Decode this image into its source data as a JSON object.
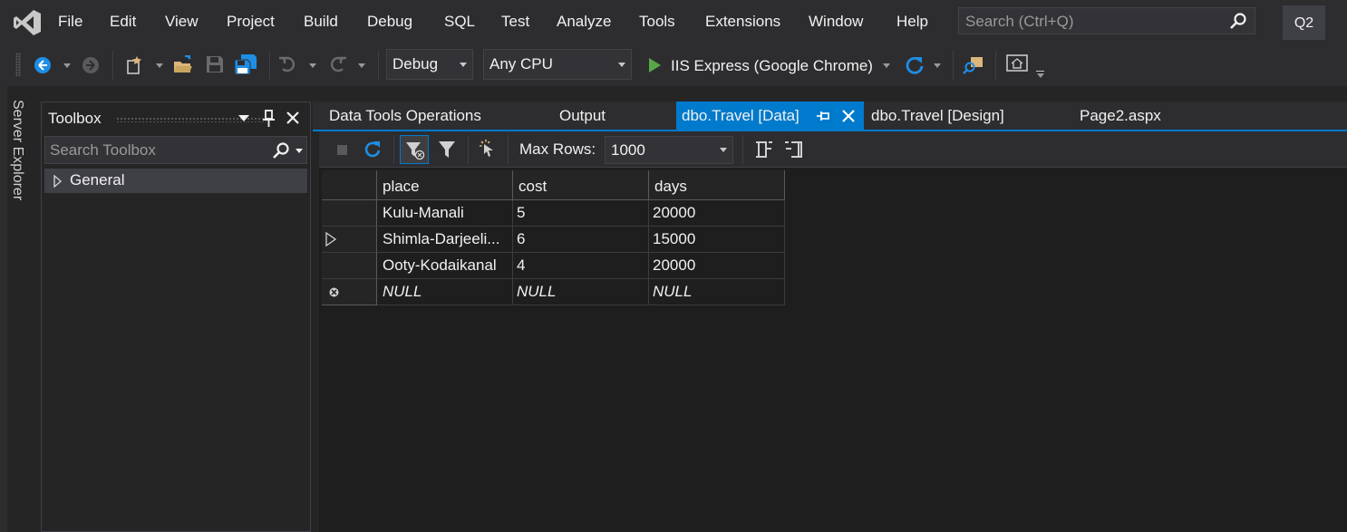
{
  "menu": {
    "items": [
      "File",
      "Edit",
      "View",
      "Project",
      "Build",
      "Debug",
      "SQL",
      "Test",
      "Analyze",
      "Tools",
      "Extensions",
      "Window",
      "Help"
    ],
    "search_placeholder": "Search (Ctrl+Q)",
    "solution_badge": "Q2"
  },
  "toolbar": {
    "configuration": "Debug",
    "platform": "Any CPU",
    "run_target": "IIS Express (Google Chrome)"
  },
  "side_tab": {
    "label": "Server Explorer"
  },
  "toolbox": {
    "title": "Toolbox",
    "search_placeholder": "Search Toolbox",
    "groups": [
      "General"
    ]
  },
  "doc_tabs": [
    {
      "label": "Data Tools Operations",
      "active": false
    },
    {
      "label": "Output",
      "active": false
    },
    {
      "label": "dbo.Travel [Data]",
      "active": true
    },
    {
      "label": "dbo.Travel [Design]",
      "active": false
    },
    {
      "label": "Page2.aspx",
      "active": false
    }
  ],
  "data_toolbar": {
    "max_rows_label": "Max Rows:",
    "max_rows_value": "1000"
  },
  "grid": {
    "columns": [
      "place",
      "cost",
      "days"
    ],
    "rows": [
      [
        "Kulu-Manali",
        "5",
        "20000"
      ],
      [
        "Shimla-Darjeeli...",
        "6",
        "15000"
      ],
      [
        "Ooty-Kodaikanal",
        "4",
        "20000"
      ]
    ],
    "current_row_index": 1,
    "new_row": [
      "NULL",
      "NULL",
      "NULL"
    ]
  },
  "colors": {
    "accent": "#007acc",
    "background": "#252526",
    "chrome": "#2d2d30",
    "grid_bg": "#1e1e1e",
    "run_green": "#57a64a",
    "refresh_blue": "#1e8ee5",
    "folder_yellow": "#dcb67a"
  }
}
